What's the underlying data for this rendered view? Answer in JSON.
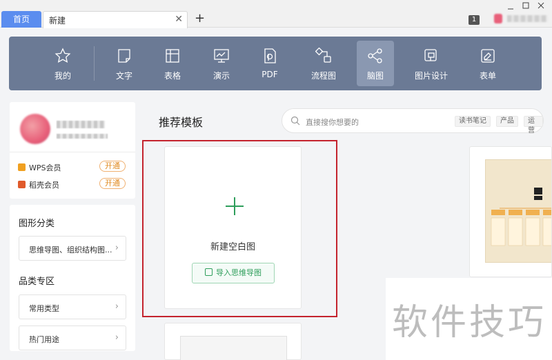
{
  "tabs": {
    "home_label": "首页",
    "new_label": "新建",
    "close_glyph": "✕",
    "add_glyph": "+"
  },
  "titlebar": {
    "badge": "1"
  },
  "toolbar": {
    "items": [
      {
        "label": "我的",
        "icon": "star-icon"
      },
      {
        "label": "文字",
        "icon": "document-icon"
      },
      {
        "label": "表格",
        "icon": "table-icon"
      },
      {
        "label": "演示",
        "icon": "presentation-icon"
      },
      {
        "label": "PDF",
        "icon": "pdf-icon"
      },
      {
        "label": "流程图",
        "icon": "flowchart-icon"
      },
      {
        "label": "脑图",
        "icon": "mindmap-icon"
      },
      {
        "label": "图片设计",
        "icon": "image-design-icon"
      },
      {
        "label": "表单",
        "icon": "form-icon"
      }
    ],
    "active": "脑图"
  },
  "sidebar": {
    "members": [
      {
        "label": "WPS会员",
        "action": "开通"
      },
      {
        "label": "稻壳会员",
        "action": "开通"
      }
    ],
    "sections": [
      {
        "heading": "图形分类",
        "items": [
          "思维导图、组织结构图..."
        ]
      },
      {
        "heading": "品类专区",
        "items": [
          "常用类型",
          "热门用途"
        ]
      }
    ]
  },
  "main": {
    "title": "推荐模板",
    "search_placeholder": "直接搜你想要的",
    "tags": [
      "读书笔记",
      "产品",
      "运营"
    ],
    "new_card": {
      "label": "新建空白图",
      "import_label": "导入思维导图"
    }
  },
  "watermark": "软件技巧",
  "colors": {
    "toolbar_bg": "#6b7a95",
    "accent_green": "#2e9e5b",
    "highlight_red": "#c4232d",
    "tab_blue": "#5b8def"
  }
}
